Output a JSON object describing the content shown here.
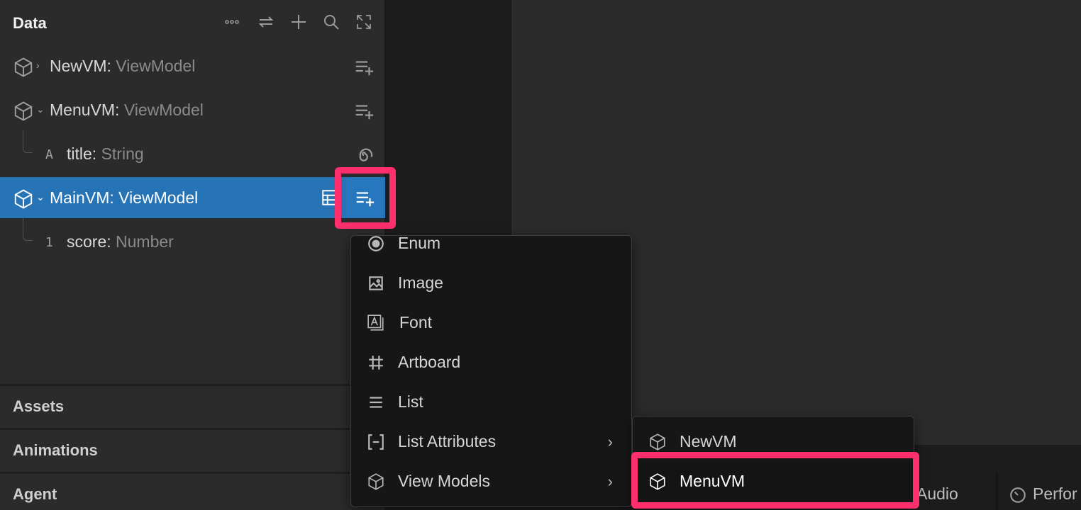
{
  "data_panel": {
    "title": "Data",
    "header_icons": [
      "more-icon",
      "swap-icon",
      "add-icon",
      "search-icon",
      "expand-icon"
    ],
    "tree": [
      {
        "name": "NewVM:",
        "type": "ViewModel",
        "icon": "cube-icon",
        "expander": "›"
      },
      {
        "name": "MenuVM:",
        "type": "ViewModel",
        "icon": "cube-icon",
        "expander": "⌄"
      },
      {
        "name": "title:",
        "type": "String",
        "glyph": "A"
      },
      {
        "name": "MainVM:",
        "type": "ViewModel",
        "icon": "cube-icon",
        "expander": "⌄",
        "selected": true
      },
      {
        "name": "score:",
        "type": "Number",
        "glyph": "1"
      }
    ]
  },
  "sections": {
    "assets": "Assets",
    "animations": "Animations",
    "agent": "Agent"
  },
  "add_property_menu": {
    "items": [
      {
        "label": "Enum",
        "icon": "radio-icon"
      },
      {
        "label": "Image",
        "icon": "image-icon"
      },
      {
        "label": "Font",
        "icon": "font-icon"
      },
      {
        "label": "Artboard",
        "icon": "artboard-icon"
      },
      {
        "label": "List",
        "icon": "list-icon"
      },
      {
        "label": "List Attributes",
        "icon": "list-attributes-icon",
        "submenu": "›"
      },
      {
        "label": "View Models",
        "icon": "cube-icon",
        "submenu": "›"
      }
    ]
  },
  "view_models_submenu": {
    "items": [
      {
        "label": "NewVM",
        "icon": "cube-icon"
      },
      {
        "label": "MenuVM",
        "icon": "cube-icon",
        "highlighted": true
      }
    ]
  },
  "bottom_tabs": {
    "audio": "Audio",
    "performance": "Perfor"
  },
  "colors": {
    "selection": "#2673b5",
    "highlight": "#ff2f6e",
    "panel": "#2b2b2b",
    "menu": "#161616"
  }
}
